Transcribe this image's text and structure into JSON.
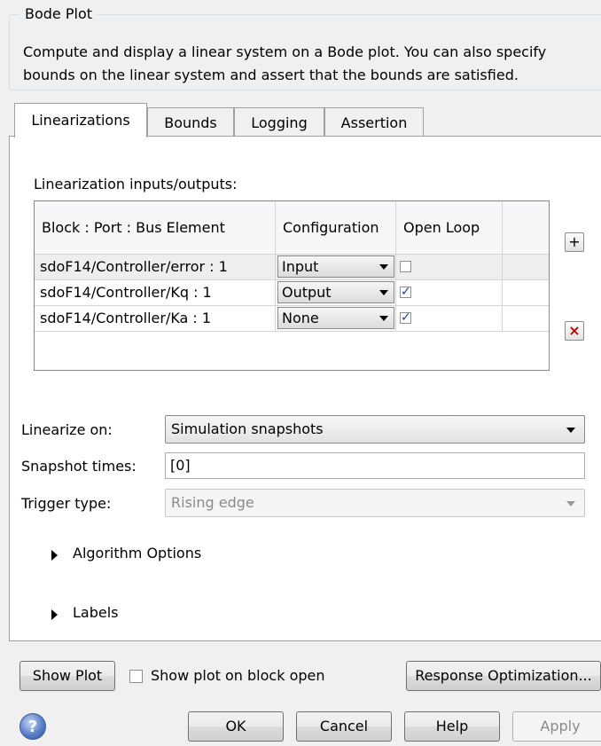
{
  "group": {
    "title": "Bode Plot",
    "description": "Compute and display a linear system on a Bode plot. You can also specify bounds on the linear system and assert that the bounds are satisfied."
  },
  "tabs": [
    {
      "label": "Linearizations",
      "active": true
    },
    {
      "label": "Bounds",
      "active": false
    },
    {
      "label": "Logging",
      "active": false
    },
    {
      "label": "Assertion",
      "active": false
    }
  ],
  "linearizations": {
    "io_label": "Linearization inputs/outputs:",
    "columns": [
      "Block : Port : Bus Element",
      "Configuration",
      "Open Loop"
    ],
    "rows": [
      {
        "block": "sdoF14/Controller/error : 1",
        "configuration": "Input",
        "open_loop": false
      },
      {
        "block": "sdoF14/Controller/Kq : 1",
        "configuration": "Output",
        "open_loop": true
      },
      {
        "block": "sdoF14/Controller/Ka : 1",
        "configuration": "None",
        "open_loop": true
      }
    ],
    "add_icon": "plus-icon",
    "delete_icon": "delete-x-icon",
    "linearize_on_label": "Linearize on:",
    "linearize_on_value": "Simulation snapshots",
    "snapshot_label": "Snapshot times:",
    "snapshot_value": "[0]",
    "trigger_label": "Trigger type:",
    "trigger_value": "Rising edge",
    "algorithm_options": "Algorithm Options",
    "labels": "Labels"
  },
  "bottom": {
    "show_plot": "Show Plot",
    "show_on_open": "Show plot on block open",
    "response_opt": "Response Optimization...",
    "ok": "OK",
    "cancel": "Cancel",
    "help": "Help",
    "apply": "Apply",
    "help_icon_glyph": "?"
  },
  "colors": {
    "check_blue": "#1a3f9c",
    "delete_red": "#c00000"
  }
}
